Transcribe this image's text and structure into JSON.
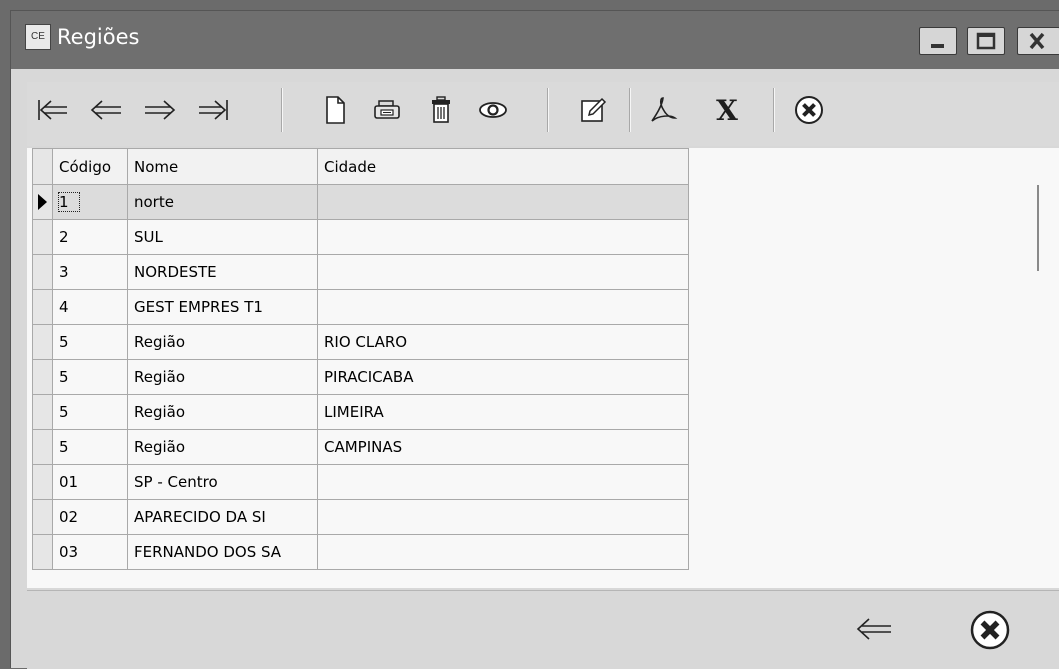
{
  "window": {
    "app_icon_text": "CE",
    "title": "Regiões",
    "controls": {
      "minimize": "_",
      "maximize": "□",
      "close": "X"
    }
  },
  "toolbar": {
    "items": [
      {
        "name": "first-record",
        "icon": "first-arrow-icon"
      },
      {
        "name": "previous-record",
        "icon": "left-arrow-icon"
      },
      {
        "name": "next-record",
        "icon": "right-arrow-icon"
      },
      {
        "name": "last-record",
        "icon": "last-arrow-icon"
      },
      {
        "name": "new-record",
        "icon": "new-document-icon"
      },
      {
        "name": "print",
        "icon": "printer-icon"
      },
      {
        "name": "delete",
        "icon": "trash-icon"
      },
      {
        "name": "view",
        "icon": "eye-icon"
      },
      {
        "name": "edit",
        "icon": "edit-icon"
      },
      {
        "name": "pdf",
        "icon": "pdf-icon"
      },
      {
        "name": "excel",
        "icon": "excel-x-icon",
        "glyph": "X"
      },
      {
        "name": "cancel",
        "icon": "cancel-circle-icon"
      }
    ]
  },
  "grid": {
    "columns": [
      "Código",
      "Nome",
      "Cidade"
    ],
    "rows": [
      {
        "codigo": "1",
        "nome": "norte",
        "cidade": ""
      },
      {
        "codigo": "2",
        "nome": "SUL",
        "cidade": ""
      },
      {
        "codigo": "3",
        "nome": "NORDESTE",
        "cidade": ""
      },
      {
        "codigo": "4",
        "nome": "GEST EMPRES T1",
        "cidade": ""
      },
      {
        "codigo": "5",
        "nome": "Região",
        "cidade": "RIO CLARO"
      },
      {
        "codigo": "5",
        "nome": "Região",
        "cidade": "PIRACICABA"
      },
      {
        "codigo": "5",
        "nome": "Região",
        "cidade": "LIMEIRA"
      },
      {
        "codigo": "5",
        "nome": "Região",
        "cidade": "CAMPINAS"
      },
      {
        "codigo": "01",
        "nome": "SP - Centro",
        "cidade": ""
      },
      {
        "codigo": "02",
        "nome": "APARECIDO DA SI",
        "cidade": ""
      },
      {
        "codigo": "03",
        "nome": "FERNANDO DOS SA",
        "cidade": ""
      }
    ],
    "selected_row_index": 0
  },
  "bottom": {
    "buttons": [
      {
        "name": "back",
        "icon": "left-arrow-icon"
      },
      {
        "name": "close",
        "icon": "cancel-circle-icon"
      }
    ]
  }
}
